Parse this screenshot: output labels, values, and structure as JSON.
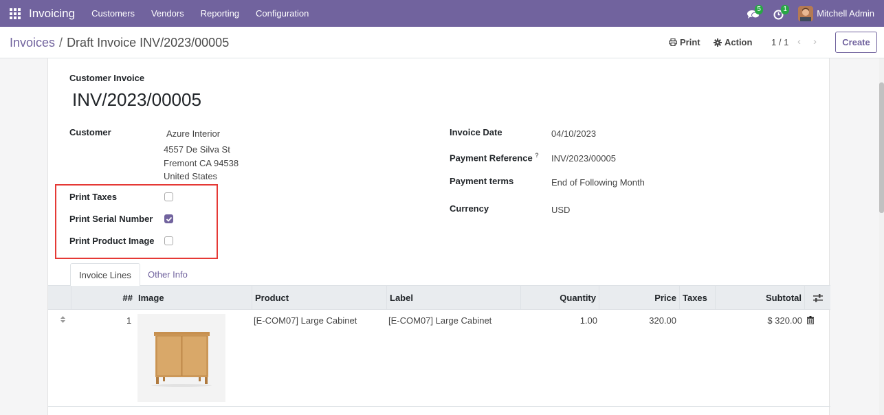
{
  "navbar": {
    "app_name": "Invoicing",
    "menu": [
      "Customers",
      "Vendors",
      "Reporting",
      "Configuration"
    ],
    "messages_count": "5",
    "activities_count": "1",
    "user_name": "Mitchell Admin"
  },
  "control_panel": {
    "breadcrumb_root": "Invoices",
    "breadcrumb_separator": "/",
    "breadcrumb_current": "Draft Invoice INV/2023/00005",
    "print_label": "Print",
    "action_label": "Action",
    "pager": "1 / 1",
    "create_label": "Create"
  },
  "invoice": {
    "type_label": "Customer Invoice",
    "number": "INV/2023/00005",
    "customer_label": "Customer",
    "customer_name": "Azure Interior",
    "address_line1": "4557 De Silva St",
    "address_line2": "Fremont CA 94538",
    "address_line3": "United States",
    "print_taxes_label": "Print Taxes",
    "print_taxes": false,
    "print_serial_label": "Print Serial Number",
    "print_serial": true,
    "print_image_label": "Print Product Image",
    "print_image": false,
    "invoice_date_label": "Invoice Date",
    "invoice_date": "04/10/2023",
    "payment_ref_label": "Payment Reference",
    "payment_ref_help": "?",
    "payment_ref": "INV/2023/00005",
    "payment_terms_label": "Payment terms",
    "payment_terms": "End of Following Month",
    "currency_label": "Currency",
    "currency": "USD"
  },
  "tabs": [
    "Invoice Lines",
    "Other Info"
  ],
  "lines": {
    "headers": {
      "seq": "##",
      "image": "Image",
      "product": "Product",
      "label": "Label",
      "quantity": "Quantity",
      "price": "Price",
      "taxes": "Taxes",
      "subtotal": "Subtotal"
    },
    "rows": [
      {
        "seq": "1",
        "product": "[E-COM07] Large Cabinet",
        "label": "[E-COM07] Large Cabinet",
        "quantity": "1.00",
        "price": "320.00",
        "taxes": "",
        "subtotal": "$ 320.00"
      }
    ]
  },
  "icons": {
    "apps": "apps-grid-icon",
    "messages": "chat-icon",
    "activities": "clock-icon",
    "print": "printer-icon",
    "action": "gear-icon",
    "row_handle": "drag-handle-icon",
    "delete": "trash-icon",
    "optional_columns": "sliders-icon"
  },
  "colors": {
    "brand": "#71639e",
    "badge": "#28a745",
    "highlight_box": "#e53935"
  }
}
